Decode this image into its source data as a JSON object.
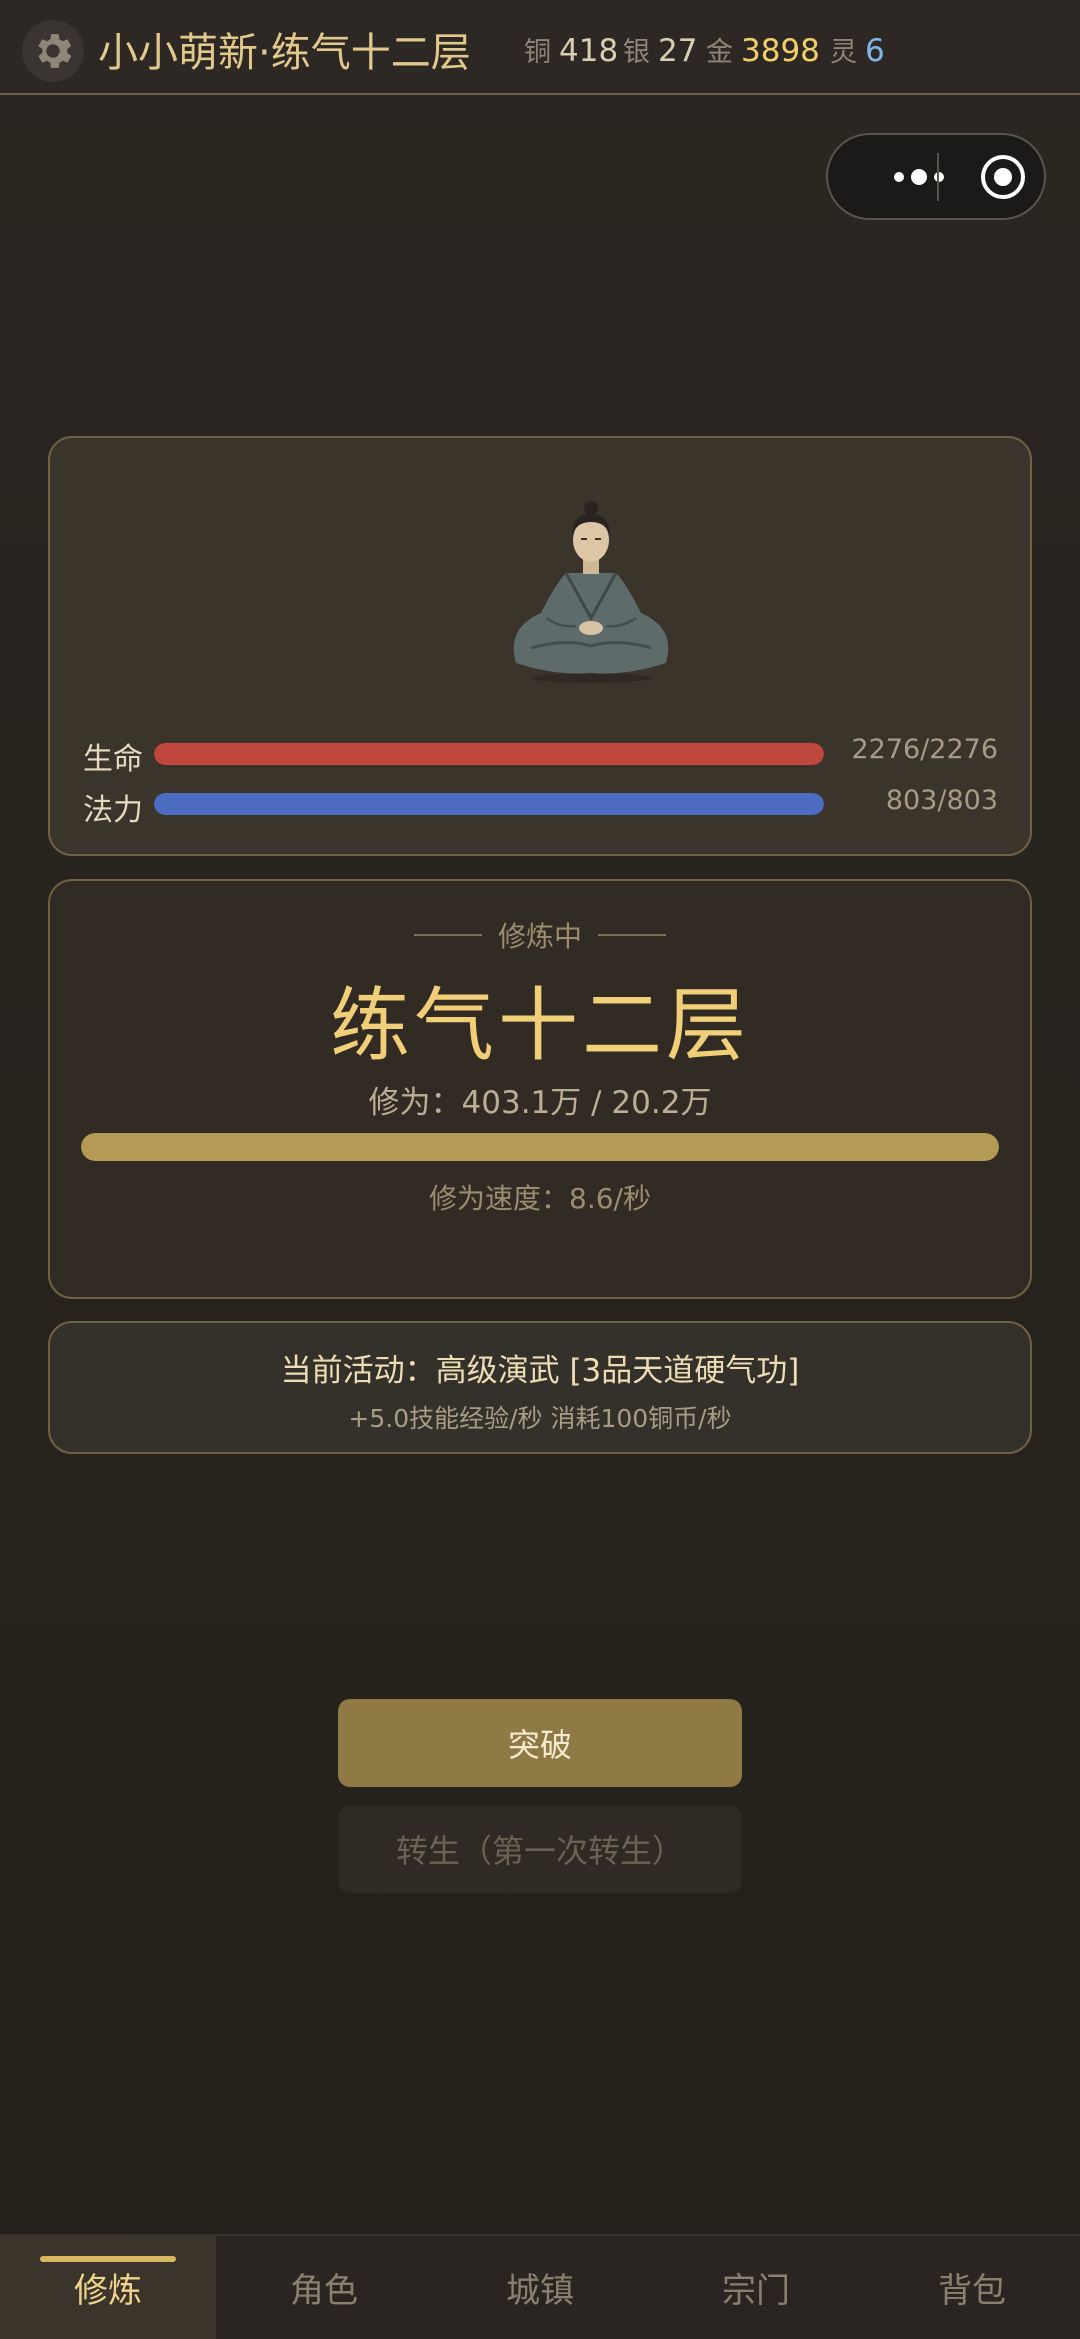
{
  "header": {
    "player_name": "小小萌新·练气十二层",
    "currencies": [
      {
        "label": "铜",
        "value": "418",
        "color": "#d9cdb2"
      },
      {
        "label": "银",
        "value": "27",
        "color": "#d9cdb2"
      },
      {
        "label": "金",
        "value": "3898",
        "color": "#f2cf6b"
      },
      {
        "label": "灵",
        "value": "6",
        "color": "#7fb6e8"
      }
    ]
  },
  "character": {
    "hp_label": "生命",
    "hp_value": "2276/2276",
    "hp_fraction": 1.0,
    "hp_color": "#c0473d",
    "mp_label": "法力",
    "mp_value": "803/803",
    "mp_fraction": 1.0,
    "mp_color": "#4b6cc0"
  },
  "cultivation": {
    "status": "修炼中",
    "realm": "练气十二层",
    "progress_text": "修为：403.1万 / 20.2万",
    "progress_fraction": 1.0,
    "speed_text": "修为速度：8.6/秒"
  },
  "activity": {
    "title": "当前活动：高级演武 [3品天道硬气功]",
    "subtitle": "+5.0技能经验/秒  消耗100铜币/秒"
  },
  "buttons": {
    "breakthrough": "突破",
    "rebirth": "转生（第一次转生）"
  },
  "tabs": [
    {
      "label": "修炼",
      "active": true
    },
    {
      "label": "角色",
      "active": false
    },
    {
      "label": "城镇",
      "active": false
    },
    {
      "label": "宗门",
      "active": false
    },
    {
      "label": "背包",
      "active": false
    }
  ]
}
